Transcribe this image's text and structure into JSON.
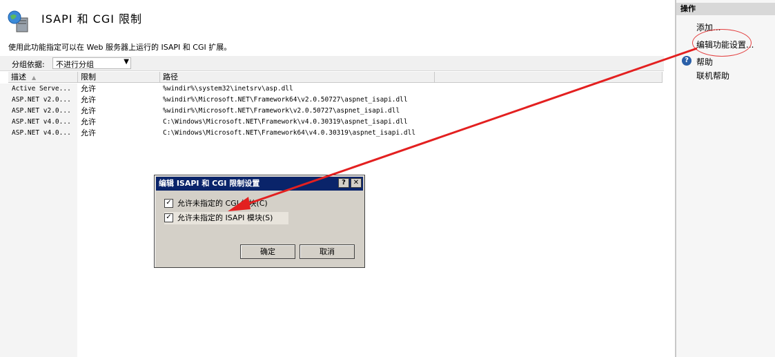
{
  "page": {
    "title": "ISAPI 和 CGI 限制",
    "description": "使用此功能指定可以在 Web 服务器上运行的 ISAPI 和 CGI 扩展。"
  },
  "groupbar": {
    "label": "分组依据:",
    "selected": "不进行分组"
  },
  "table": {
    "columns": [
      "描述",
      "限制",
      "路径"
    ],
    "rows": [
      {
        "desc": "Active Serve...",
        "restriction": "允许",
        "path": "%windir%\\system32\\inetsrv\\asp.dll"
      },
      {
        "desc": "ASP.NET v2.0...",
        "restriction": "允许",
        "path": "%windir%\\Microsoft.NET\\Framework64\\v2.0.50727\\aspnet_isapi.dll"
      },
      {
        "desc": "ASP.NET v2.0...",
        "restriction": "允许",
        "path": "%windir%\\Microsoft.NET\\Framework\\v2.0.50727\\aspnet_isapi.dll"
      },
      {
        "desc": "ASP.NET v4.0...",
        "restriction": "允许",
        "path": "C:\\Windows\\Microsoft.NET\\Framework\\v4.0.30319\\aspnet_isapi.dll"
      },
      {
        "desc": "ASP.NET v4.0...",
        "restriction": "允许",
        "path": "C:\\Windows\\Microsoft.NET\\Framework64\\v4.0.30319\\aspnet_isapi.dll"
      }
    ]
  },
  "actions": {
    "header": "操作",
    "items": [
      {
        "label": "添加..."
      },
      {
        "label": "编辑功能设置..."
      },
      {
        "label": "帮助"
      },
      {
        "label": "联机帮助"
      }
    ]
  },
  "dialog": {
    "title": "编辑 ISAPI 和 CGI 限制设置",
    "help_btn": "?",
    "close_btn": "✕",
    "options": [
      {
        "label": "允许未指定的 CGI 模块(C)",
        "checked": true
      },
      {
        "label": "允许未指定的 ISAPI 模块(S)",
        "checked": true
      }
    ],
    "ok": "确定",
    "cancel": "取消"
  },
  "colors": {
    "annotation": "#e32020",
    "dialog_title": "#0a246a"
  }
}
